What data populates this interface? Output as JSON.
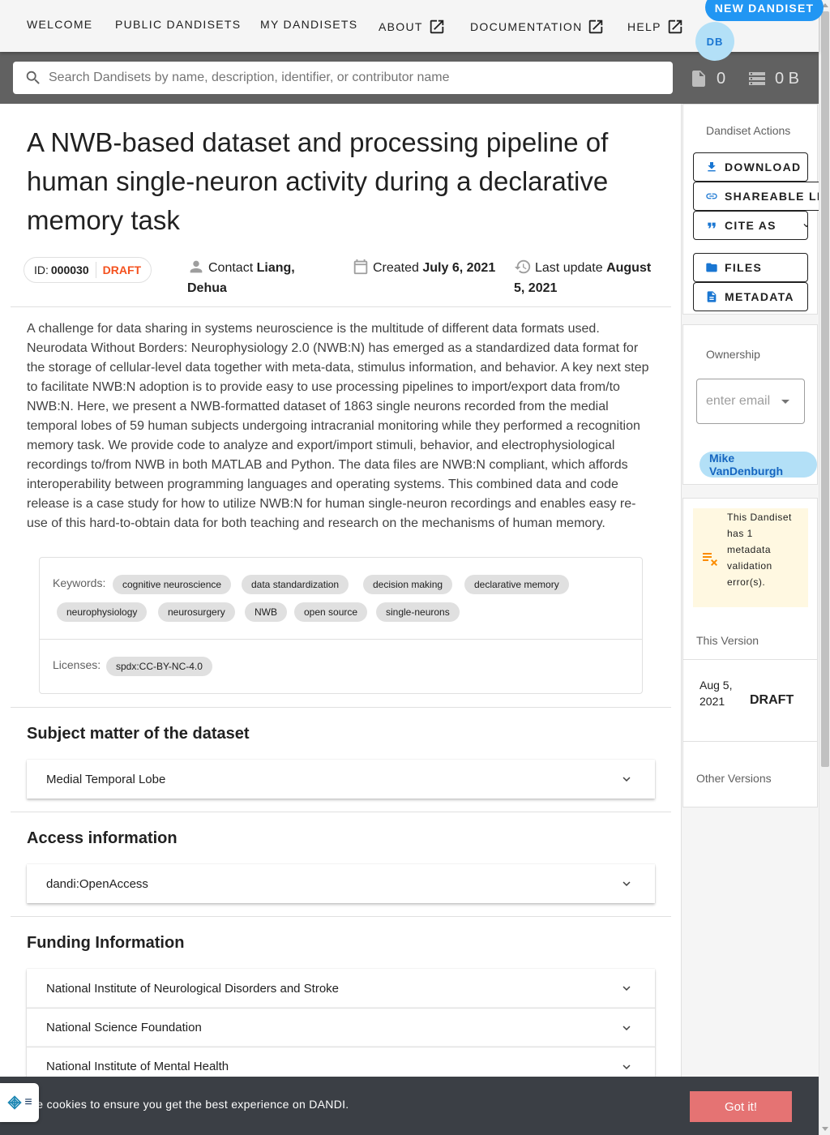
{
  "nav": {
    "items": [
      {
        "label": "WELCOME",
        "external": false
      },
      {
        "label": "PUBLIC DANDISETS",
        "external": false
      },
      {
        "label": "MY DANDISETS",
        "external": false
      },
      {
        "label": "ABOUT",
        "external": true
      },
      {
        "label": "DOCUMENTATION",
        "external": true
      },
      {
        "label": "HELP",
        "external": true
      }
    ],
    "new_button": "NEW DANDISET",
    "avatar_initials": "DB"
  },
  "search": {
    "placeholder": "Search Dandisets by name, description, identifier, or contributor name",
    "value": ""
  },
  "stats": {
    "files": "0",
    "size": "0 B"
  },
  "dandiset": {
    "title": "A NWB-based dataset and processing pipeline of human single-neuron activity during a declarative memory task",
    "id_label": "ID:",
    "id": "000030",
    "status": "DRAFT",
    "contact_label": "Contact",
    "contact_name": "Liang, Dehua",
    "created_label": "Created",
    "created_date": "July 6, 2021",
    "updated_label": "Last update",
    "updated_date": "August 5, 2021",
    "description": "A challenge for data sharing in systems neuroscience is the multitude of different data formats used. Neurodata Without Borders: Neurophysiology 2.0 (NWB:N) has emerged as a standardized data format for the storage of cellular-level data together with meta-data, stimulus information, and behavior. A key next step to facilitate NWB:N adoption is to provide easy to use processing pipelines to import/export data from/to NWB:N. Here, we present a NWB-formatted dataset of 1863 single neurons recorded from the medial temporal lobes of 59 human subjects undergoing intracranial monitoring while they performed a recognition memory task. We provide code to analyze and export/import stimuli, behavior, and electrophysiological recordings to/from NWB in both MATLAB and Python. The data files are NWB:N compliant, which affords interoperability between programming languages and operating systems. This combined data and code release is a case study for how to utilize NWB:N for human single-neuron recordings and enables easy re-use of this hard-to-obtain data for both teaching and research on the mechanisms of human memory.",
    "keywords_label": "Keywords:",
    "keywords": [
      "cognitive neuroscience",
      "data standardization",
      "decision making",
      "declarative memory",
      "neurophysiology",
      "neurosurgery",
      "NWB",
      "open source",
      "single-neurons"
    ],
    "licenses_label": "Licenses:",
    "licenses": [
      "spdx:CC-BY-NC-4.0"
    ]
  },
  "sections": {
    "subject": {
      "title": "Subject matter of the dataset",
      "items": [
        "Medial Temporal Lobe"
      ]
    },
    "access": {
      "title": "Access information",
      "items": [
        "dandi:OpenAccess"
      ]
    },
    "funding": {
      "title": "Funding Information",
      "items": [
        "National Institute of Neurological Disorders and Stroke",
        "National Science Foundation",
        "National Institute of Mental Health"
      ]
    }
  },
  "sidebar": {
    "actions_label": "Dandiset Actions",
    "download": "DOWNLOAD",
    "shareable": "SHAREABLE LINK",
    "cite": "CITE AS",
    "files": "FILES",
    "metadata": "METADATA",
    "ownership_label": "Ownership",
    "ownership_placeholder": "enter email",
    "owner": "Mike VanDenburgh",
    "validation_message": "This Dandiset has 1 metadata validation error(s).",
    "this_version_label": "This Version",
    "version_date": "Aug 5, 2021",
    "version_status": "DRAFT",
    "other_versions_label": "Other Versions"
  },
  "cookie": {
    "text": "se cookies to ensure you get the best experience on DANDI.",
    "button": "Got it!"
  },
  "colors": {
    "accent": "#2196f3",
    "draft": "#f4511e",
    "searchbar": "#616161",
    "cookie_bg": "#3b3f45",
    "cookie_btn": "#e57373",
    "warning_bg": "#fff8e1",
    "warning_icon": "#fb8c00"
  }
}
